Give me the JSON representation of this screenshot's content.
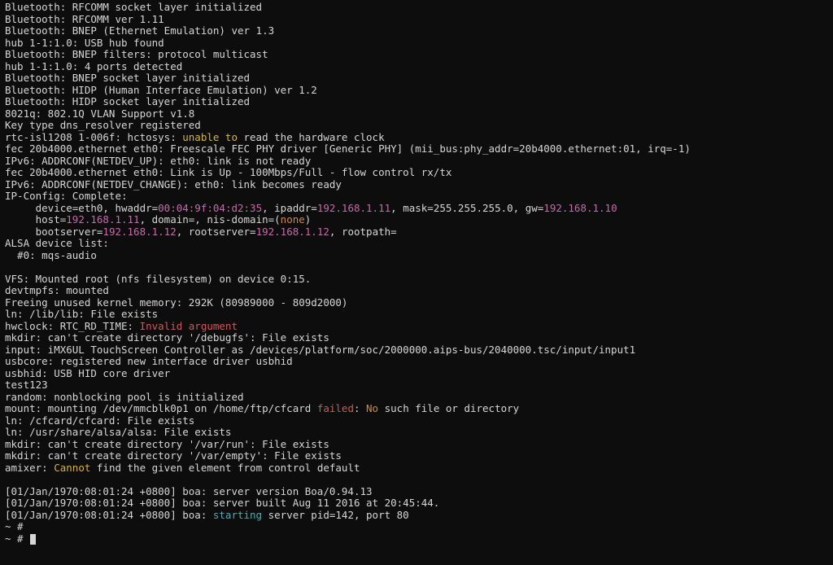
{
  "lines": [
    [
      {
        "t": "Bluetooth: RFCOMM socket layer initialized"
      }
    ],
    [
      {
        "t": "Bluetooth: RFCOMM ver 1.11"
      }
    ],
    [
      {
        "t": "Bluetooth: BNEP (Ethernet Emulation) ver 1.3"
      }
    ],
    [
      {
        "t": "hub 1-1:1.0: USB hub found"
      }
    ],
    [
      {
        "t": "Bluetooth: BNEP filters: protocol multicast"
      }
    ],
    [
      {
        "t": "hub 1-1:1.0: 4 ports detected"
      }
    ],
    [
      {
        "t": "Bluetooth: BNEP socket layer initialized"
      }
    ],
    [
      {
        "t": "Bluetooth: HIDP (Human Interface Emulation) ver 1.2"
      }
    ],
    [
      {
        "t": "Bluetooth: HIDP socket layer initialized"
      }
    ],
    [
      {
        "t": "8021q: 802.1Q VLAN Support v1.8"
      }
    ],
    [
      {
        "t": "Key type dns_resolver registered"
      }
    ],
    [
      {
        "t": "rtc-isl1208 1-006f: hctosys: "
      },
      {
        "t": "unable to",
        "c": "yellow"
      },
      {
        "t": " read the hardware clock"
      }
    ],
    [
      {
        "t": "fec 20b4000.ethernet eth0: Freescale FEC PHY driver [Generic PHY] (mii_bus:phy_addr=20b4000.ethernet:01, irq=-1)"
      }
    ],
    [
      {
        "t": "IPv6: ADDRCONF(NETDEV_UP): eth0: link is not ready"
      }
    ],
    [
      {
        "t": "fec 20b4000.ethernet eth0: Link is Up - 100Mbps/Full - flow control rx/tx"
      }
    ],
    [
      {
        "t": "IPv6: ADDRCONF(NETDEV_CHANGE): eth0: link becomes ready"
      }
    ],
    [
      {
        "t": "IP-Config: Complete:"
      }
    ],
    [
      {
        "t": "     device=eth0, hwaddr="
      },
      {
        "t": "00:04:9f:04:d2:35",
        "c": "magenta"
      },
      {
        "t": ", ipaddr="
      },
      {
        "t": "192.168.1.11",
        "c": "magenta"
      },
      {
        "t": ", mask=255.255.255.0, gw="
      },
      {
        "t": "192.168.1.10",
        "c": "magenta"
      }
    ],
    [
      {
        "t": "     host="
      },
      {
        "t": "192.168.1.11",
        "c": "magenta"
      },
      {
        "t": ", domain=, nis-domain=("
      },
      {
        "t": "none",
        "c": "orange"
      },
      {
        "t": ")"
      }
    ],
    [
      {
        "t": "     bootserver="
      },
      {
        "t": "192.168.1.12",
        "c": "magenta"
      },
      {
        "t": ", rootserver="
      },
      {
        "t": "192.168.1.12",
        "c": "magenta"
      },
      {
        "t": ", rootpath="
      }
    ],
    [
      {
        "t": "ALSA device list:"
      }
    ],
    [
      {
        "t": "  #0: mqs-audio"
      }
    ],
    [
      {
        "t": ""
      }
    ],
    [
      {
        "t": "VFS: Mounted root (nfs filesystem) on device 0:15."
      }
    ],
    [
      {
        "t": "devtmpfs: mounted"
      }
    ],
    [
      {
        "t": "Freeing unused kernel memory: 292K (80989000 - 809d2000)"
      }
    ],
    [
      {
        "t": "ln: /lib/lib: File exists"
      }
    ],
    [
      {
        "t": "hwclock: RTC_RD_TIME: "
      },
      {
        "t": "Invalid argument",
        "c": "red"
      }
    ],
    [
      {
        "t": "mkdir: can't create directory '/debugfs': File exists"
      }
    ],
    [
      {
        "t": "input: iMX6UL TouchScreen Controller as /devices/platform/soc/2000000.aips-bus/2040000.tsc/input/input1"
      }
    ],
    [
      {
        "t": "usbcore: registered new interface driver usbhid"
      }
    ],
    [
      {
        "t": "usbhid: USB HID core driver"
      }
    ],
    [
      {
        "t": "test123"
      }
    ],
    [
      {
        "t": "random: nonblocking pool is initialized"
      }
    ],
    [
      {
        "t": "mount: mounting /dev/mmcblk0p1 on /home/ftp/cfcard "
      },
      {
        "t": "failed",
        "c": "red"
      },
      {
        "t": ": "
      },
      {
        "t": "No",
        "c": "orange"
      },
      {
        "t": " such file or directory"
      }
    ],
    [
      {
        "t": "ln: /cfcard/cfcard: File exists"
      }
    ],
    [
      {
        "t": "ln: /usr/share/alsa/alsa: File exists"
      }
    ],
    [
      {
        "t": "mkdir: can't create directory '/var/run': File exists"
      }
    ],
    [
      {
        "t": "mkdir: can't create directory '/var/empty': File exists"
      }
    ],
    [
      {
        "t": "amixer: "
      },
      {
        "t": "Cannot",
        "c": "yellow"
      },
      {
        "t": " find the given element from control default"
      }
    ],
    [
      {
        "t": ""
      }
    ],
    [
      {
        "t": "[01/Jan/1970:08:01:24 +0800] boa: server version Boa/0.94.13"
      }
    ],
    [
      {
        "t": "[01/Jan/1970:08:01:24 +0800] boa: server built Aug 11 2016 at 20:45:44."
      }
    ],
    [
      {
        "t": "[01/Jan/1970:08:01:24 +0800] boa: "
      },
      {
        "t": "starting",
        "c": "cyan"
      },
      {
        "t": " server pid=142, port 80"
      }
    ],
    [
      {
        "t": "~ # "
      }
    ],
    [
      {
        "t": "~ # "
      },
      {
        "cursor": true
      }
    ]
  ]
}
